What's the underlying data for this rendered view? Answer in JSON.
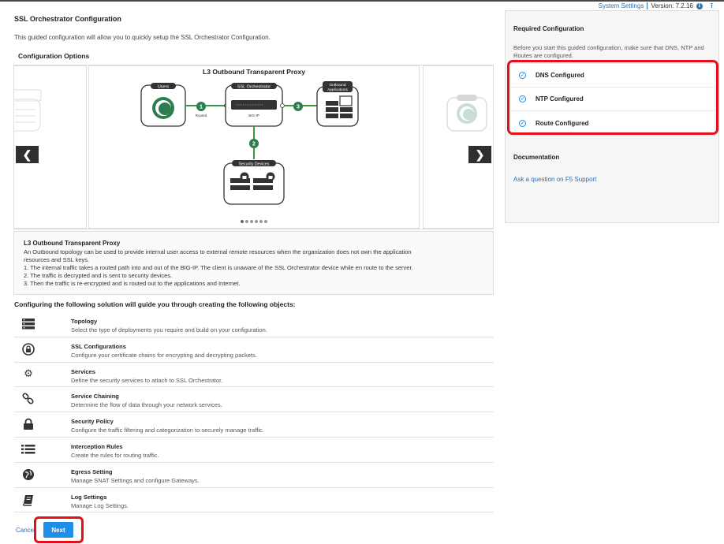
{
  "topbar": {
    "settings_link": "System Settings",
    "version": "Version: 7.2.16"
  },
  "page": {
    "title": "SSL Orchestrator Configuration",
    "intro": "This guided configuration will allow you to quickly setup the SSL Orchestrator Configuration.",
    "options_title": "Configuration Options"
  },
  "carousel": {
    "title": "L3 Outbound Transparent Proxy",
    "diagram": {
      "users": "Users",
      "ssl_orchestrator": "SSL Orchestrator",
      "big_ip": "BIG-IP",
      "outbound_line1": "Outbound",
      "outbound_line2": "Applications",
      "security_devices": "Security Devices",
      "routed": "Routed",
      "step1": "1",
      "step2": "2",
      "step3": "3"
    },
    "right_card_label": "Users",
    "dots": 6,
    "active_dot": 0
  },
  "description": {
    "title": "L3 Outbound Transparent Proxy",
    "lines": [
      "An Outbound topology can be used to provide internal user access to external remote resources when the organization does not own the application",
      "resources and SSL keys.",
      "1. The internal traffic takes a routed path into and out of the BIG-IP. The client is unaware of the SSL Orchestrator device while en route to the server.",
      "2. The traffic is decrypted and is sent to security devices.",
      "3. Then the traffic is re-encrypted and is routed out to the applications and Internet."
    ]
  },
  "objects": {
    "title": "Configuring the following solution will guide you through creating the following objects:",
    "items": [
      {
        "icon": "server-stack-icon",
        "label": "Topology",
        "desc": "Select the type of deployments you require and build on your configuration."
      },
      {
        "icon": "lock-circle-icon",
        "label": "SSL Configurations",
        "desc": "Configure your certificate chains for encrypting and decrypting packets."
      },
      {
        "icon": "gears-icon",
        "label": "Services",
        "desc": "Define the security services to attach to SSL Orchestrator."
      },
      {
        "icon": "link-icon",
        "label": "Service Chaining",
        "desc": "Determine the flow of data through your network services."
      },
      {
        "icon": "lock-icon",
        "label": "Security Policy",
        "desc": "Configure the traffic filtering and categorization to securely manage traffic."
      },
      {
        "icon": "list-icon",
        "label": "Interception Rules",
        "desc": "Create the rules for routing traffic."
      },
      {
        "icon": "globe-icon",
        "label": "Egress Setting",
        "desc": "Manage SNAT Settings and configure Gateways."
      },
      {
        "icon": "book-icon",
        "label": "Log Settings",
        "desc": "Manage Log Settings."
      }
    ]
  },
  "footer": {
    "cancel_label": "Cancel",
    "next_label": "Next"
  },
  "sidebar": {
    "required_title": "Required Configuration",
    "required_text": "Before you start this guided configuration, make sure that DNS, NTP and Routes are configured.",
    "checks": [
      "DNS Configured",
      "NTP Configured",
      "Route Configured"
    ],
    "doc_title": "Documentation",
    "doc_link": "Ask a question on F5 Support"
  },
  "colors": {
    "accent": "#1e8ee8",
    "highlight": "#e3101a",
    "diagram_green": "#2e7d4f",
    "link": "#2d6fb5"
  }
}
